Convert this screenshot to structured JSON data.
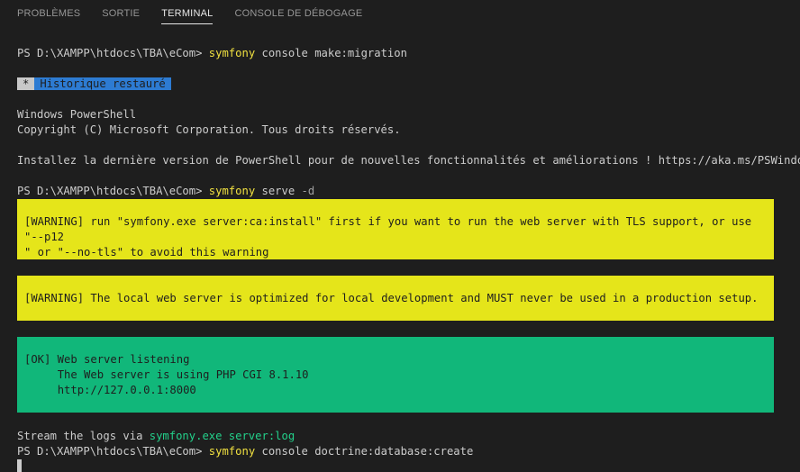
{
  "tabs": [
    {
      "label": "PROBLÈMES"
    },
    {
      "label": "SORTIE"
    },
    {
      "label": "TERMINAL",
      "active": true
    },
    {
      "label": "CONSOLE DE DÉBOGAGE"
    }
  ],
  "terminal": {
    "prompt": "PS D:\\XAMPP\\htdocs\\TBA\\eCom> ",
    "cmd1": {
      "exe": "symfony",
      "args": " console make:migration"
    },
    "history_badge": {
      "star": "*",
      "text": "Historique restauré"
    },
    "ps_header_1": "Windows PowerShell",
    "ps_header_2": "Copyright (C) Microsoft Corporation. Tous droits réservés.",
    "ps_header_3": "Installez la dernière version de PowerShell pour de nouvelles fonctionnalités et améliorations ! https://aka.ms/PSWindows",
    "cmd2": {
      "exe": "symfony",
      "args": " serve ",
      "flag": "-d"
    },
    "warning1": "[WARNING] run \"symfony.exe server:ca:install\" first if you want to run the web server with TLS support, or use \"--p12\n\" or \"--no-tls\" to avoid this warning",
    "warning2": "[WARNING] The local web server is optimized for local development and MUST never be used in a production setup.",
    "ok_line1": "[OK] Web server listening",
    "ok_line2": "     The Web server is using PHP CGI 8.1.10",
    "ok_line3": "     http://127.0.0.1:8000",
    "logs_prefix": "Stream the logs via ",
    "logs_cmd": "symfony.exe server:log",
    "cmd3": {
      "exe": "symfony",
      "args": " console doctrine:database:create"
    }
  },
  "colors": {
    "background": "#1e1e1e",
    "text": "#cccccc",
    "command_yellow": "#f0e040",
    "warning_bg": "#e5e51a",
    "ok_bg": "#11b77a",
    "badge_blue": "#2d7bd2",
    "link_green": "#23d18b"
  }
}
